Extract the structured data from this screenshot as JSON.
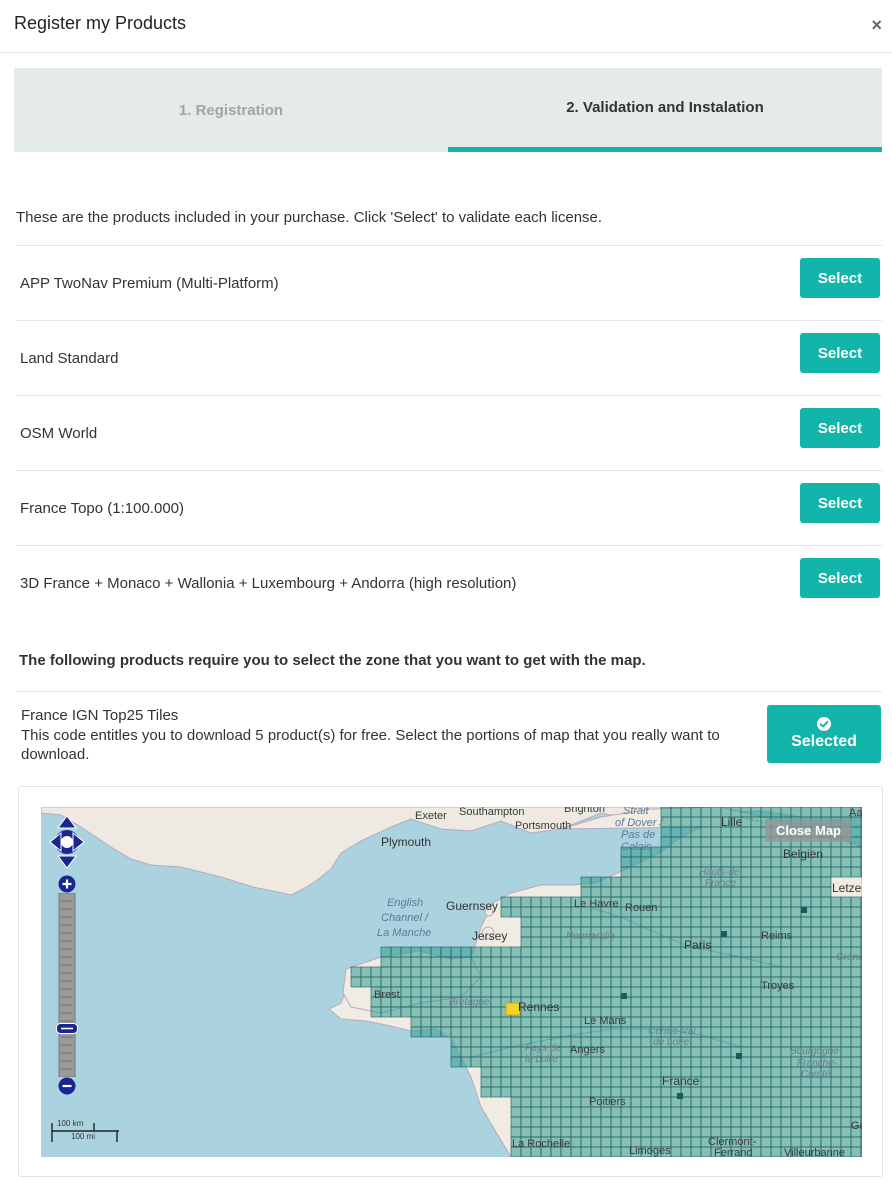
{
  "dialog": {
    "title": "Register my Products",
    "close_label": "×"
  },
  "tabs": [
    {
      "label": "1. Registration",
      "active": false
    },
    {
      "label": "2. Validation and Instalation",
      "active": true
    }
  ],
  "intro_text": "These are the products included in your purchase. Click 'Select' to validate each license.",
  "products": [
    {
      "name": "APP TwoNav Premium (Multi-Platform)",
      "button": "Select"
    },
    {
      "name": "Land Standard",
      "button": "Select"
    },
    {
      "name": "OSM World",
      "button": "Select"
    },
    {
      "name": "France Topo (1:100.000)",
      "button": "Select"
    },
    {
      "name": "3D France + Monaco + Wallonia + Luxembourg + Andorra (high resolution)",
      "button": "Select"
    }
  ],
  "zone_note": "The following products require you to select the zone that you want to get with the map.",
  "zone_product": {
    "title": "France IGN Top25 Tiles",
    "description": "This code entitles you to download 5 product(s) for free. Select the portions of map that you really want to download.",
    "button": "Selected"
  },
  "map": {
    "close_button": "Close Map",
    "scale_km": "100 km",
    "scale_mi": "100 mi",
    "labels": {
      "exeter": "Exeter",
      "southampton": "Southampton",
      "portsmouth": "Portsmouth",
      "brighton": "Brighton",
      "plymouth": "Plymouth",
      "strait1": "Strait",
      "strait2": "of Dover /",
      "strait3": "Pas de",
      "strait4": "Calais",
      "lille": "Lille",
      "aa": "Aa",
      "belgien": "Belgien",
      "letze": "Letze",
      "english1": "English",
      "english2": "Channel /",
      "english3": "La Manche",
      "guernsey": "Guernsey",
      "jersey": "Jersey",
      "le_havre": "Le Havre",
      "rouen": "Rouen",
      "normandie": "Normandie",
      "hauts": "Hauts-de",
      "france_r": "France",
      "paris": "Paris",
      "reims": "Reims",
      "brest": "Brest",
      "bretagne": "Bretagne",
      "rennes": "Rennes",
      "le_mans": "Le Mans",
      "centre1": "Centre-Val",
      "centre2": "de Loire",
      "troyes": "Troyes",
      "pays1": "Pays de",
      "pays2": "la Loire",
      "angers": "Angers",
      "bourgogne1": "Bourgogne-",
      "bourgogne2": "Franche-",
      "bourgogne3": "Comté",
      "france": "France",
      "poitiers": "Poitiers",
      "la_rochelle": "La Rochelle",
      "limoges": "Limoges",
      "clermont1": "Clermont-",
      "clermont2": "Ferrand",
      "villeurbanne": "Villeurbanne",
      "grand": "Grand",
      "ge": "Ge"
    }
  },
  "colors": {
    "accent": "#13b5aa",
    "tab_bg": "#e4ebea",
    "sea": "#aad3df",
    "tile_fill": "#2d9b8f",
    "tile_line": "#1c5a59",
    "selected_tile": "#f2d231",
    "control_blue": "#1a2790"
  }
}
